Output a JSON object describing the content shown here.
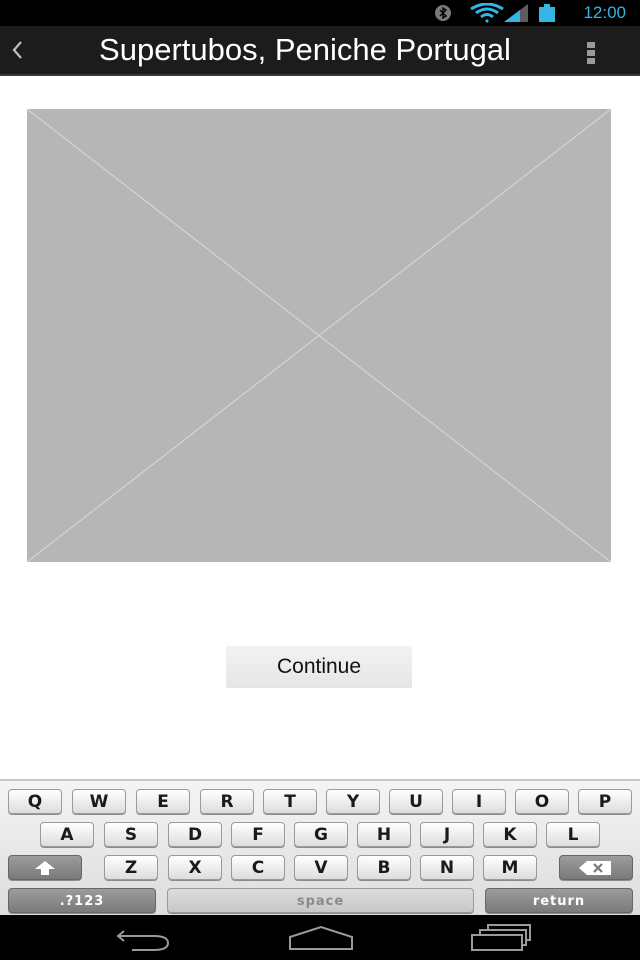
{
  "status_bar": {
    "time": "12:00",
    "icons": [
      "bluetooth-icon",
      "wifi-icon",
      "signal-icon",
      "battery-icon"
    ],
    "accent_color": "#33b5e5"
  },
  "action_bar": {
    "title": "Supertubos, Peniche Portugal",
    "back_icon": "chevron-left-icon",
    "menu_icon": "overflow-menu-icon"
  },
  "main": {
    "image_placeholder": "image-placeholder",
    "continue_label": "Continue"
  },
  "keyboard": {
    "row1": [
      "Q",
      "W",
      "E",
      "R",
      "T",
      "Y",
      "U",
      "I",
      "O",
      "P"
    ],
    "row2": [
      "A",
      "S",
      "D",
      "F",
      "G",
      "H",
      "J",
      "K",
      "L"
    ],
    "row3": [
      "Z",
      "X",
      "C",
      "V",
      "B",
      "N",
      "M"
    ],
    "symbols_label": ".?123",
    "space_label": "space",
    "return_label": "return",
    "shift_icon": "shift-icon",
    "backspace_icon": "backspace-icon"
  },
  "nav_bar": {
    "buttons": [
      "back-nav-icon",
      "home-nav-icon",
      "recents-nav-icon"
    ]
  }
}
